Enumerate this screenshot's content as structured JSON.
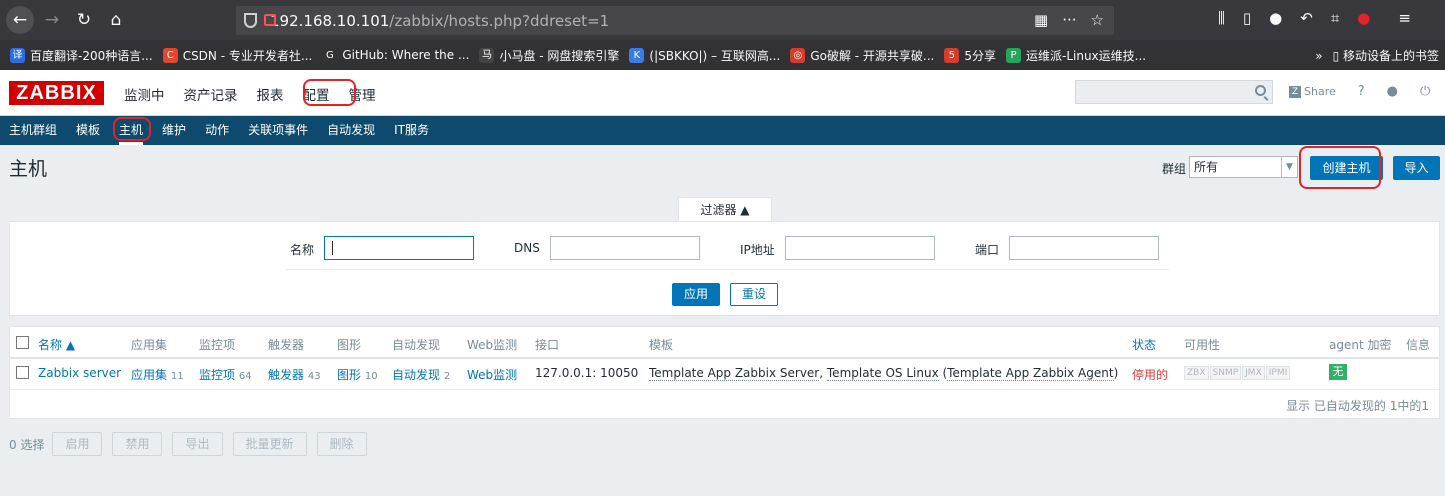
{
  "browser": {
    "url_host": "192.168.10.101",
    "url_path": "/zabbix/hosts.php?ddreset=1",
    "bookmarks": [
      {
        "label": "百度翻译-200种语言...",
        "icon": "译",
        "color": "#2b6de8"
      },
      {
        "label": "CSDN - 专业开发者社...",
        "icon": "C",
        "color": "#e5452b"
      },
      {
        "label": "GitHub: Where the ...",
        "icon": "G",
        "color": "#333333"
      },
      {
        "label": "小马盘 - 网盘搜索引擎",
        "icon": "马",
        "color": "#444444"
      },
      {
        "label": "(|SBKKO|) – 互联网高...",
        "icon": "K",
        "color": "#3b7be8"
      },
      {
        "label": "Go破解 - 开源共享破...",
        "icon": "◎",
        "color": "#d43d2c"
      },
      {
        "label": "5分享",
        "icon": "5",
        "color": "#d43d2c"
      },
      {
        "label": "运维派-Linux运维技...",
        "icon": "P",
        "color": "#27a35a"
      }
    ],
    "mobile_bookmarks": "移动设备上的书签"
  },
  "header": {
    "logo": "ZABBIX",
    "menu": [
      "监测中",
      "资产记录",
      "报表",
      "配置",
      "管理"
    ],
    "share_label": "Share",
    "help": "?"
  },
  "submenu": [
    "主机群组",
    "模板",
    "主机",
    "维护",
    "动作",
    "关联项事件",
    "自动发现",
    "IT服务"
  ],
  "page": {
    "title": "主机",
    "group_label": "群组",
    "group_value": "所有",
    "create_button": "创建主机",
    "import_button": "导入"
  },
  "filter": {
    "tab_label": "过滤器 ▲",
    "name_label": "名称",
    "dns_label": "DNS",
    "ip_label": "IP地址",
    "port_label": "端口",
    "apply_button": "应用",
    "reset_button": "重设"
  },
  "table": {
    "headers": {
      "name": "名称 ▲",
      "applications": "应用集",
      "items": "监控项",
      "triggers": "触发器",
      "graphs": "图形",
      "discovery": "自动发现",
      "web": "Web监测",
      "interface": "接口",
      "templates": "模板",
      "status": "状态",
      "availability": "可用性",
      "agent_encryption": "agent 加密",
      "info": "信息"
    },
    "row": {
      "name": "Zabbix server",
      "applications": "应用集",
      "applications_count": "11",
      "items": "监控项",
      "items_count": "64",
      "triggers": "触发器",
      "triggers_count": "43",
      "graphs": "图形",
      "graphs_count": "10",
      "discovery": "自动发现",
      "discovery_count": "2",
      "web": "Web监测",
      "interface": "127.0.0.1: 10050",
      "template1": "Template App Zabbix Server",
      "template_sep": ", ",
      "template2": "Template OS Linux",
      "template3_open": " (",
      "template3": "Template App Zabbix Agent",
      "template3_close": ")",
      "status": "停用的",
      "availability": [
        "ZBX",
        "SNMP",
        "JMX",
        "IPMI"
      ],
      "encryption": "无"
    },
    "footer": "显示 已自动发现的 1中的1"
  },
  "actions": {
    "selected": "0 选择",
    "buttons": [
      "启用",
      "禁用",
      "导出",
      "批量更新",
      "删除"
    ]
  }
}
